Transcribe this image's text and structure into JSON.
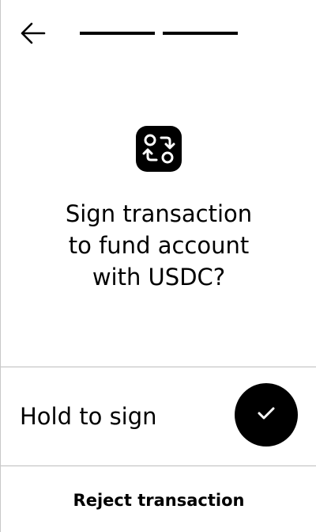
{
  "header": {
    "back_icon": "arrow-left-icon",
    "progress_steps": 2,
    "progress_completed": 2
  },
  "main": {
    "icon": "swap-arrows-icon",
    "title": "Sign transaction\nto fund account\nwith USDC?"
  },
  "actions": {
    "hold_label": "Hold to sign",
    "hold_icon": "check-icon",
    "reject_label": "Reject transaction"
  },
  "colors": {
    "primary": "#000000",
    "background": "#ffffff",
    "divider": "#bdbdbd"
  }
}
